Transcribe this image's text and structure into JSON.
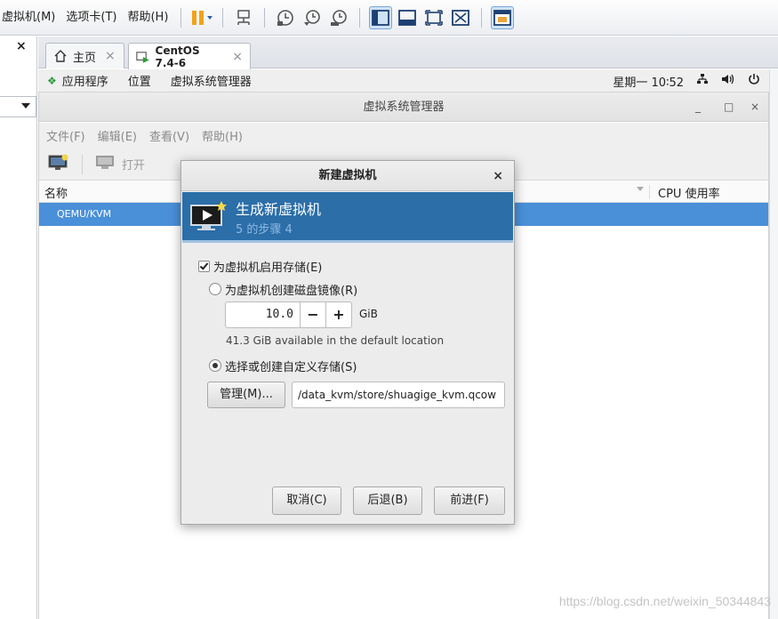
{
  "vmware": {
    "menus": [
      "虚拟机(M)",
      "选项卡(T)",
      "帮助(H)"
    ],
    "left_close": "×",
    "tabs": [
      {
        "label": "主页",
        "close": "×"
      },
      {
        "label": "CentOS 7.4-6",
        "close": "×"
      }
    ]
  },
  "gnome": {
    "apps": "应用程序",
    "places": "位置",
    "vmm": "虚拟系统管理器",
    "clock": "星期一 10∶52"
  },
  "vmm": {
    "title": "虚拟系统管理器",
    "minimize": "_",
    "maximize": "□",
    "close": "×",
    "menus": [
      "文件(F)",
      "编辑(E)",
      "查看(V)",
      "帮助(H)"
    ],
    "open": "打开",
    "col_name": "名称",
    "col_cpu": "CPU 使用率",
    "row": "QEMU/KVM"
  },
  "dialog": {
    "title": "新建虚拟机",
    "close": "×",
    "banner_title": "生成新虚拟机",
    "banner_sub": "5 的步骤 4",
    "enable_storage": {
      "label": "为虚拟机启用存储(E)",
      "checked": true
    },
    "create_image": {
      "label": "为虚拟机创建磁盘镜像(R)",
      "selected": false
    },
    "size_value": "10.0",
    "minus": "−",
    "plus": "+",
    "unit": "GiB",
    "available": "41.3 GiB available in the default location",
    "custom_storage": {
      "label": "选择或创建自定义存储(S)",
      "selected": true
    },
    "manage": "管理(M)...",
    "path": "/data_kvm/store/shuagige_kvm.qcow",
    "buttons": {
      "cancel": "取消(C)",
      "back": "后退(B)",
      "forward": "前进(F)"
    }
  },
  "watermark": "https://blog.csdn.net/weixin_50344843"
}
